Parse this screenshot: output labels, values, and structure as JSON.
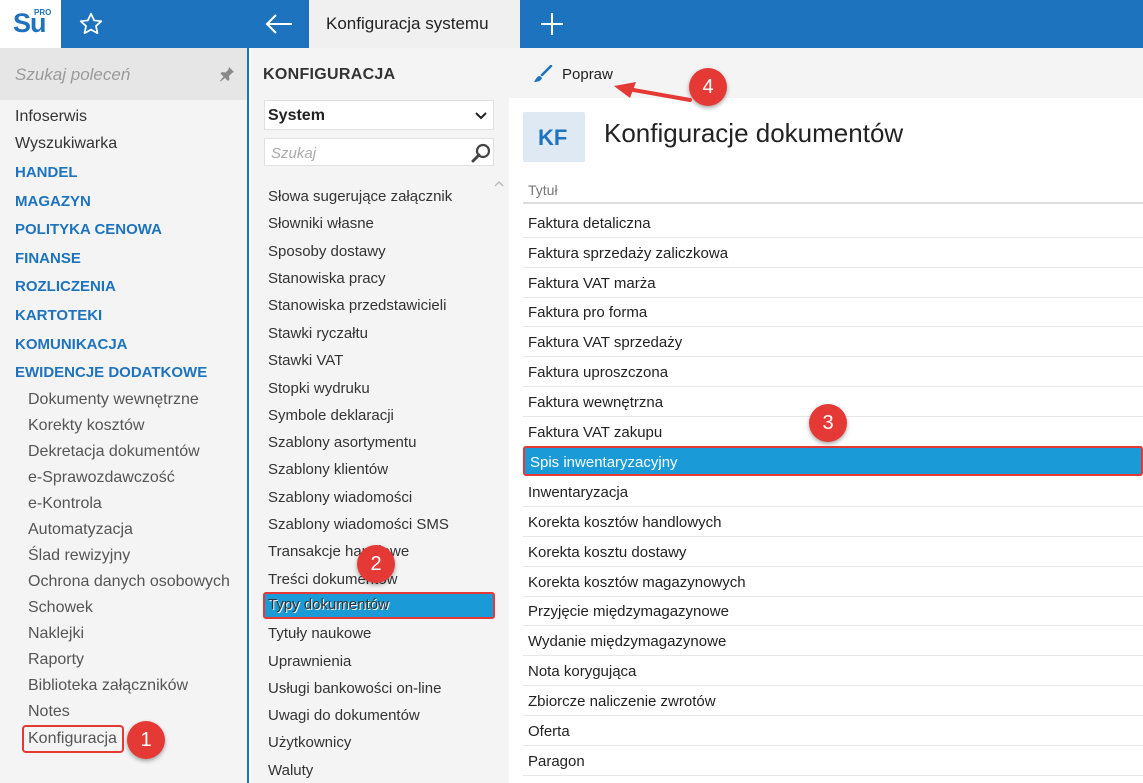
{
  "header": {
    "logo_text": "Su",
    "logo_badge": "PRO",
    "active_tab": "Konfiguracja systemu"
  },
  "sidebar": {
    "search_placeholder": "Szukaj poleceń",
    "top_items": [
      "Infoserwis",
      "Wyszukiwarka"
    ],
    "sections": [
      "HANDEL",
      "MAGAZYN",
      "POLITYKA CENOWA",
      "FINANSE",
      "ROZLICZENIA",
      "KARTOTEKI",
      "KOMUNIKACJA",
      "EWIDENCJE DODATKOWE"
    ],
    "sub_items": [
      "Dokumenty wewnętrzne",
      "Korekty kosztów",
      "Dekretacja dokumentów",
      "e-Sprawozdawczość",
      "e-Kontrola",
      "Automatyzacja",
      "Ślad rewizyjny",
      "Ochrona danych osobowych",
      "Schowek",
      "Naklejki",
      "Raporty",
      "Biblioteka załączników",
      "Notes",
      "Konfiguracja"
    ]
  },
  "config_panel": {
    "title": "KONFIGURACJA",
    "selected_option": "System",
    "search_placeholder": "Szukaj",
    "items": [
      "Słowa sugerujące załącznik",
      "Słowniki własne",
      "Sposoby dostawy",
      "Stanowiska pracy",
      "Stanowiska przedstawicieli",
      "Stawki ryczałtu",
      "Stawki VAT",
      "Stopki wydruku",
      "Symbole deklaracji",
      "Szablony asortymentu",
      "Szablony klientów",
      "Szablony wiadomości",
      "Szablony wiadomości SMS",
      "Transakcje handlowe",
      "Treści dokumentów",
      "Typy dokumentów",
      "Tytuły naukowe",
      "Uprawnienia",
      "Usługi bankowości on-line",
      "Uwagi do dokumentów",
      "Użytkownicy",
      "Waluty"
    ],
    "selected_item": "Typy dokumentów"
  },
  "main": {
    "edit_button": "Popraw",
    "badge": "KF",
    "title": "Konfiguracje dokumentów",
    "column_header": "Tytuł",
    "rows": [
      "Faktura detaliczna",
      "Faktura sprzedaży zaliczkowa",
      "Faktura VAT marża",
      "Faktura pro forma",
      "Faktura VAT sprzedaży",
      "Faktura uproszczona",
      "Faktura wewnętrzna",
      "Faktura VAT zakupu",
      "Spis inwentaryzacyjny",
      "Inwentaryzacja",
      "Korekta kosztów handlowych",
      "Korekta kosztu dostawy",
      "Korekta kosztów magazynowych",
      "Przyjęcie międzymagazynowe",
      "Wydanie międzymagazynowe",
      "Nota korygująca",
      "Zbiorcze naliczenie zwrotów",
      "Oferta",
      "Paragon"
    ],
    "selected_row": "Spis inwentaryzacyjny"
  },
  "callouts": [
    "1",
    "2",
    "3",
    "4"
  ],
  "colors": {
    "accent": "#1e73be",
    "selection": "#1a9bd7",
    "highlight": "#e53935"
  }
}
